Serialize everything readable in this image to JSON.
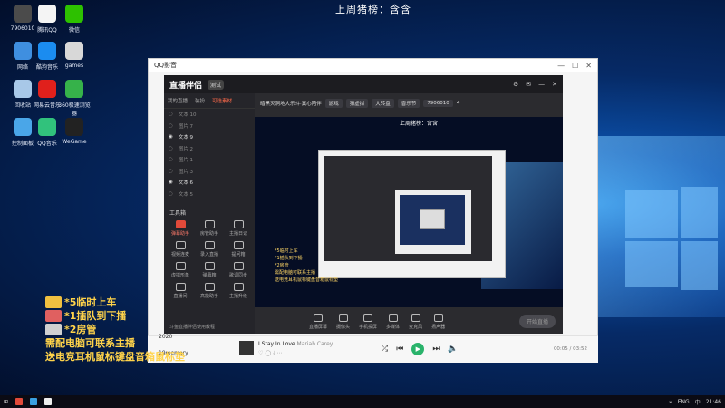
{
  "banner": "上周猪榜：含含",
  "desktop_icons": [
    {
      "label": "7906010",
      "color": "#4b4b4b"
    },
    {
      "label": "腾讯QQ",
      "color": "#f4f4f4"
    },
    {
      "label": "微信",
      "color": "#2dc100"
    },
    {
      "label": "网络",
      "color": "#3f8fe0"
    },
    {
      "label": "酷狗音乐",
      "color": "#1b8cf0"
    },
    {
      "label": "games",
      "color": "#d8d8d8"
    },
    {
      "label": "回收站",
      "color": "#a8c8e8"
    },
    {
      "label": "网易云音乐",
      "color": "#e0201c"
    },
    {
      "label": "360极速浏览器",
      "color": "#36b24a"
    },
    {
      "label": "控制面板",
      "color": "#4aa6e8"
    },
    {
      "label": "QQ音乐",
      "color": "#31c27c"
    },
    {
      "label": "WeGame",
      "color": "#222222"
    }
  ],
  "outer_window": {
    "logo": "QQ影音",
    "controls": [
      "—",
      "☐",
      "✕"
    ]
  },
  "app": {
    "name": "直播伴侣",
    "version": "测试",
    "left_tabs": [
      "我的直播",
      "装扮",
      "可选素材"
    ],
    "layers": [
      {
        "name": "文本 10",
        "visible": false
      },
      {
        "name": "图片 7",
        "visible": false
      },
      {
        "name": "文本 9",
        "visible": true
      },
      {
        "name": "图片 2",
        "visible": false
      },
      {
        "name": "图片 1",
        "visible": false
      },
      {
        "name": "图片 3",
        "visible": false
      },
      {
        "name": "文本 6",
        "visible": true
      },
      {
        "name": "文本 5",
        "visible": false
      }
    ],
    "tools_title": "工具箱",
    "tools": [
      {
        "label": "弹幕助手",
        "hot": true
      },
      {
        "label": "房管助手",
        "hot": false
      },
      {
        "label": "主播日记",
        "hot": false
      },
      {
        "label": "视频连麦",
        "hot": false
      },
      {
        "label": "录入直播",
        "hot": false
      },
      {
        "label": "提问箱",
        "hot": false
      },
      {
        "label": "虚拟形象",
        "hot": false
      },
      {
        "label": "弹幕箱",
        "hot": false
      },
      {
        "label": "歌词同步",
        "hot": false
      },
      {
        "label": "直播间",
        "hot": false
      },
      {
        "label": "高能助手",
        "hot": false
      },
      {
        "label": "主播升级",
        "hot": false
      }
    ],
    "footer_note": "斗鱼直播伴侣使用教程",
    "stream_title": "暗黑灭洞地大乐斗·真心陪伴",
    "stream_chips": [
      "猜虚拟",
      "大转盘",
      "音乐节",
      "7906010",
      "4"
    ],
    "tab_label": "游戏",
    "preview_banner": "上周猪榜：含含",
    "mini_overlay": [
      "*5临时上车",
      "*1插队到下播",
      "*2房管",
      "需配电脑可联系主播",
      "送电竞耳机鼠标键盘音箱鼠标垫"
    ],
    "bottom_tools": [
      "直播屏幕",
      "摄像头",
      "手机投屏",
      "多媒体",
      "麦克风",
      "扬声器"
    ],
    "start_label": "开始直播"
  },
  "player": {
    "left_label": "19memory",
    "song": "I Stay In Love",
    "artist": "Mariah Carey",
    "time": "00:05 / 03:52",
    "year": "2020"
  },
  "overlay_lines": [
    {
      "text": "*5临时上车",
      "icon_color": "#f0c040"
    },
    {
      "text": "*1插队到下播",
      "icon_color": "#e06060"
    },
    {
      "text": "*2房管",
      "icon_color": "#d0d0d0"
    },
    {
      "text": "需配电脑可联系主播",
      "icon_color": ""
    },
    {
      "text": "送电竞耳机鼠标键盘音箱鼠标垫",
      "icon_color": ""
    }
  ],
  "taskbar": {
    "lang": "ENG",
    "lang2": "中",
    "time": "21:46"
  }
}
